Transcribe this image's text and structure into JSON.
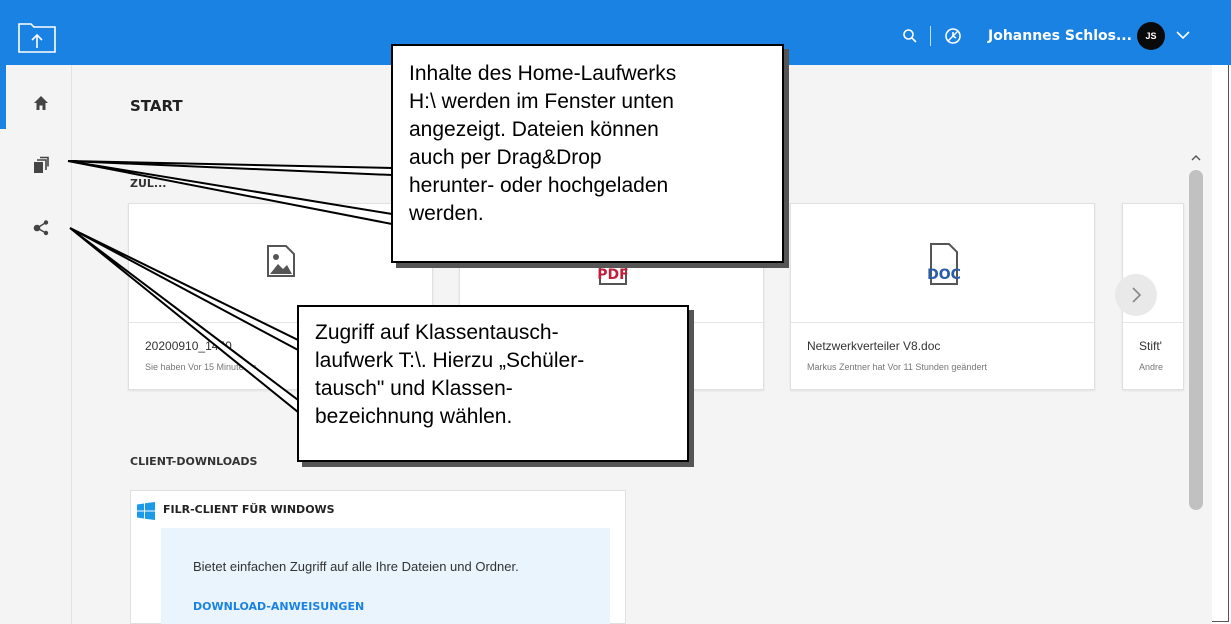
{
  "header": {
    "user_name": "Johannes Schlos...",
    "avatar_initials": "JS",
    "brand_color": "#1a82e2"
  },
  "sidebar": {
    "items": [
      {
        "icon": "home-icon"
      },
      {
        "icon": "files-icon"
      },
      {
        "icon": "share-icon"
      }
    ]
  },
  "main": {
    "title": "START",
    "recent_section_label_partial": "ZUL...",
    "recent_files": [
      {
        "name": "20200910_1450",
        "meta": "Sie haben Vor 15 Minuten g",
        "type": "image-icon"
      },
      {
        "name": "",
        "meta": "",
        "type": "pdf-icon",
        "badge": "PDF"
      },
      {
        "name": "Netzwerkverteiler V8.doc",
        "meta": "Markus Zentner hat Vor 11 Stunden geändert",
        "type": "doc-icon",
        "badge": "DOC"
      },
      {
        "name": "Stift'",
        "meta": "Andre",
        "type": "file"
      }
    ],
    "client_downloads": {
      "label": "CLIENT-DOWNLOADS",
      "card_title": "FILR-CLIENT FÜR WINDOWS",
      "description": "Bietet einfachen Zugriff auf alle Ihre Dateien und Ordner.",
      "link": "DOWNLOAD-ANWEISUNGEN"
    }
  },
  "callouts": {
    "home_drive": [
      "Inhalte des Home-Laufwerks",
      "H:\\ werden im Fenster unten",
      "angezeigt. Dateien können",
      "auch per Drag&Drop",
      "herunter- oder hochgeladen",
      "werden."
    ],
    "class_drive": [
      "Zugriff auf Klassentausch-",
      "laufwerk T:\\. Hierzu „Schüler-",
      "tausch\" und Klassen-",
      "bezeichnung wählen."
    ]
  }
}
